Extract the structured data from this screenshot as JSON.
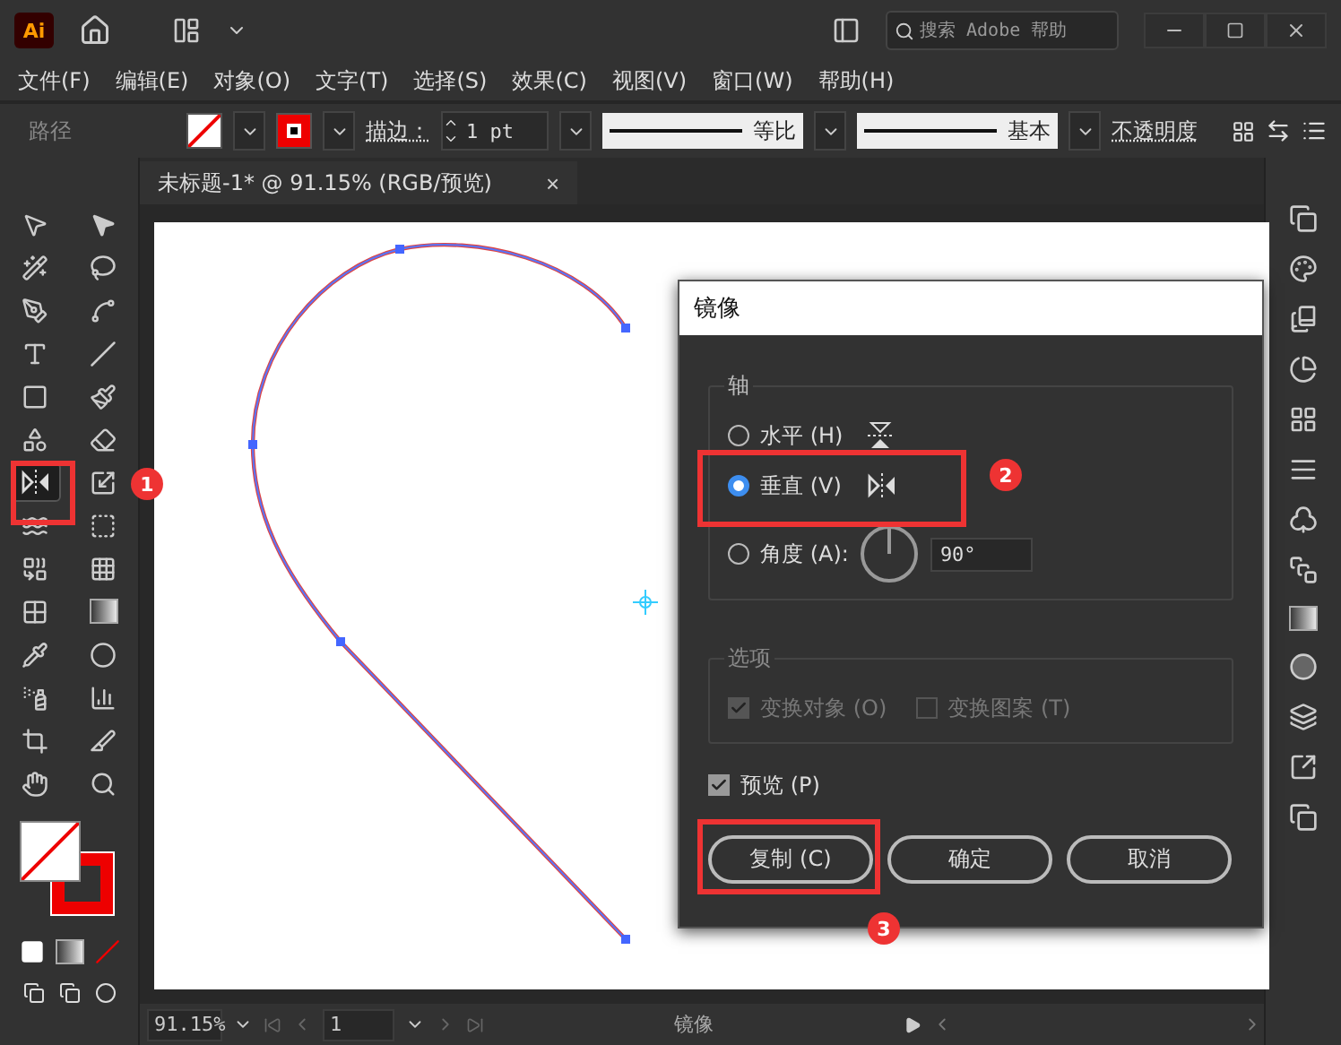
{
  "app_bar": {
    "logo": "Ai",
    "search": {
      "placeholder": "搜索 Adobe 帮助"
    }
  },
  "menu": [
    "文件(F)",
    "编辑(E)",
    "对象(O)",
    "文字(T)",
    "选择(S)",
    "效果(C)",
    "视图(V)",
    "窗口(W)",
    "帮助(H)"
  ],
  "control_bar": {
    "selection_label": "路径",
    "stroke_label": "描边：",
    "stroke_weight": "1 pt",
    "profile": "等比",
    "brush": "基本",
    "opacity_label": "不透明度"
  },
  "document_tab": {
    "title": "未标题-1* @ 91.15% (RGB/预览)",
    "close": "×"
  },
  "tools": [
    {
      "kind": "selection",
      "selected": false
    },
    {
      "kind": "direct",
      "selected": false
    },
    {
      "kind": "wand",
      "selected": false
    },
    {
      "kind": "lasso",
      "selected": false
    },
    {
      "kind": "pen",
      "selected": false
    },
    {
      "kind": "curvature",
      "selected": false
    },
    {
      "kind": "type",
      "selected": false
    },
    {
      "kind": "line",
      "selected": false
    },
    {
      "kind": "rectangle",
      "selected": false
    },
    {
      "kind": "brush",
      "selected": false
    },
    {
      "kind": "shaper",
      "selected": false
    },
    {
      "kind": "eraser",
      "selected": false
    },
    {
      "kind": "reflect",
      "selected": true
    },
    {
      "kind": "scale",
      "selected": false
    },
    {
      "kind": "warp",
      "selected": false
    },
    {
      "kind": "transform",
      "selected": false
    },
    {
      "kind": "builder",
      "selected": false
    },
    {
      "kind": "perspective",
      "selected": false
    },
    {
      "kind": "mesh",
      "selected": false
    },
    {
      "kind": "gradient",
      "selected": false
    },
    {
      "kind": "eyedropper",
      "selected": false
    },
    {
      "kind": "blend",
      "selected": false
    },
    {
      "kind": "spray",
      "selected": false
    },
    {
      "kind": "graph",
      "selected": false
    },
    {
      "kind": "artboard",
      "selected": false
    },
    {
      "kind": "slice",
      "selected": false
    },
    {
      "kind": "hand",
      "selected": false
    },
    {
      "kind": "zoom",
      "selected": false
    }
  ],
  "dialog": {
    "title": "镜像",
    "axis_group": "轴",
    "axis_options": [
      {
        "label": "水平 (H)",
        "selected": false,
        "kind": "horizontal"
      },
      {
        "label": "垂直 (V)",
        "selected": true,
        "kind": "vertical"
      },
      {
        "label": "角度 (A):",
        "selected": false,
        "kind": "angle",
        "value": "90°"
      }
    ],
    "options_group": "选项",
    "options": [
      {
        "label": "变换对象 (O)",
        "checked": true,
        "disabled": true
      },
      {
        "label": "变换图案 (T)",
        "checked": false,
        "disabled": true
      }
    ],
    "preview": {
      "label": "预览 (P)",
      "checked": true
    },
    "buttons": [
      "复制 (C)",
      "确定",
      "取消"
    ]
  },
  "annotations": [
    "1",
    "2",
    "3"
  ],
  "status_bar": {
    "zoom": "91.15%",
    "artboard": "1",
    "current_tool": "镜像"
  }
}
